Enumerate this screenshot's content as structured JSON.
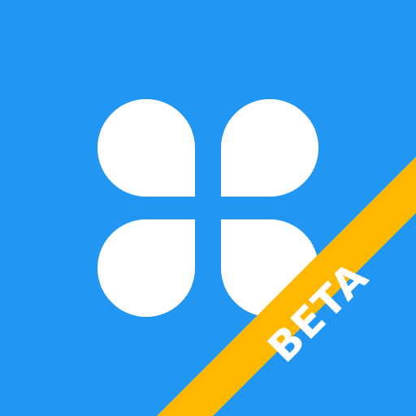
{
  "icon": {
    "name": "clover-app-icon",
    "background_color": "#2196F3",
    "petal_color": "#FFFFFF"
  },
  "ribbon": {
    "label": "BETA",
    "color": "#FFB800",
    "text_color": "#FFFFFF"
  }
}
